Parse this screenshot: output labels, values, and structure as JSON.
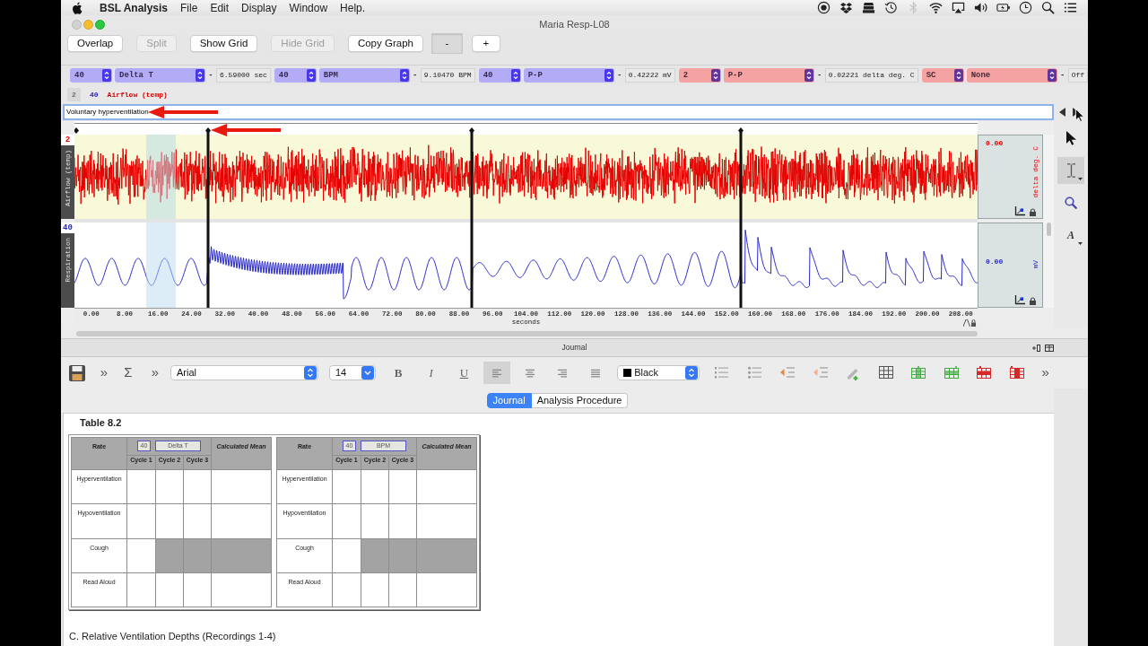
{
  "menubar": {
    "app": "BSL Analysis",
    "menus": [
      "File",
      "Edit",
      "Display",
      "Window",
      "Help."
    ]
  },
  "window": {
    "title": "Maria Resp-L08"
  },
  "toolbar": [
    {
      "label": "Overlap",
      "disabled": false,
      "pressed": false
    },
    {
      "label": "Split",
      "disabled": true,
      "pressed": false
    },
    {
      "label": "Show Grid",
      "disabled": false,
      "pressed": false
    },
    {
      "label": "Hide Grid",
      "disabled": true,
      "pressed": false
    },
    {
      "label": "Copy Graph",
      "disabled": false,
      "pressed": false
    },
    {
      "label": "-",
      "disabled": false,
      "pressed": true
    },
    {
      "label": "+",
      "disabled": false,
      "pressed": false
    }
  ],
  "measurements": [
    {
      "channel": "40",
      "type": "Delta T",
      "separator": "-",
      "result": "6.59000 sec",
      "color": "#b4abf6"
    },
    {
      "channel": "40",
      "type": "BPM",
      "separator": "-",
      "result": "9.10470 BPM",
      "color": "#b4abf6"
    },
    {
      "channel": "40",
      "type": "P-P",
      "separator": "-",
      "result": "0.42222 mV",
      "color": "#b4abf6"
    },
    {
      "channel": "2",
      "type": "P-P",
      "separator": "-",
      "result": "0.02221 delta deg. C",
      "color": "#f4a2a2"
    },
    {
      "channel": "SC",
      "type": "None",
      "separator": "-",
      "result": "Off",
      "color": "#f4a2a2"
    }
  ],
  "channel_bar": {
    "number": "2",
    "channel": "40",
    "label": "Airflow (temp)"
  },
  "event_field": {
    "value": "Voluntary hyperventilation"
  },
  "graph": {
    "channels": [
      {
        "number": "2",
        "name": "Airflow (temp)",
        "scale": "0.00",
        "unit": "delta deg. C",
        "color": "#e60000",
        "kind": "noise"
      },
      {
        "number": "40",
        "name": "Respiration",
        "scale": "0.00",
        "unit": "mV",
        "color": "#2626c8",
        "kind": "breathing"
      }
    ],
    "x_ticks": [
      "0.00",
      "8.00",
      "16.00",
      "24.00",
      "32.00",
      "40.00",
      "48.00",
      "56.00",
      "64.00",
      "72.00",
      "80.00",
      "88.00",
      "96.00",
      "104.00",
      "112.00",
      "120.00",
      "128.00",
      "136.00",
      "144.00",
      "152.00",
      "160.00",
      "168.00",
      "176.00",
      "184.00",
      "192.00",
      "200.00",
      "208.00"
    ],
    "x_label": "seconds"
  },
  "tools": [
    {
      "kind": "pointer",
      "selected": false
    },
    {
      "kind": "ibeam",
      "selected": true
    },
    {
      "kind": "zoom",
      "selected": false
    },
    {
      "kind": "text",
      "glyph": "A",
      "selected": false
    }
  ],
  "journal": {
    "title": "Journal",
    "toolbar": {
      "glyph_buttons": [
        "»",
        "Σ",
        "»"
      ],
      "font": "Arial",
      "size": "14",
      "styles": [
        {
          "glyph": "B",
          "kind": "bold"
        },
        {
          "glyph": "I",
          "kind": "italic"
        },
        {
          "glyph": "U",
          "kind": "underline"
        }
      ],
      "alignments": [
        {
          "selected": true
        },
        {
          "selected": false
        },
        {
          "selected": false
        },
        {
          "selected": false
        }
      ],
      "font_color": "Black",
      "overflow": "»"
    },
    "tabs": [
      {
        "label": "Journal",
        "selected": true
      },
      {
        "label": "Analysis Procedure",
        "selected": false
      }
    ]
  },
  "document": {
    "heading": "Table 8.2",
    "tables": [
      {
        "rate": "Rate",
        "channel": "40",
        "measurement": "Delta T",
        "mean": "Calculated Mean",
        "cycles": [
          "Cycle 1",
          "Cycle 2",
          "Cycle 3"
        ],
        "rows": [
          {
            "label": "Hyperventilation",
            "cells": [
              {
                "shaded": false
              },
              {
                "shaded": false
              },
              {
                "shaded": false
              },
              {
                "shaded": false
              }
            ]
          },
          {
            "label": "Hypoventilation",
            "cells": [
              {
                "shaded": false
              },
              {
                "shaded": false
              },
              {
                "shaded": false
              },
              {
                "shaded": false
              }
            ]
          },
          {
            "label": "Cough",
            "cells": [
              {
                "shaded": false
              },
              {
                "shaded": true
              },
              {
                "shaded": true
              },
              {
                "shaded": true
              }
            ]
          },
          {
            "label": "Read Aloud",
            "cells": [
              {
                "shaded": false
              },
              {
                "shaded": false
              },
              {
                "shaded": false
              },
              {
                "shaded": false
              }
            ]
          }
        ]
      },
      {
        "rate": "Rate",
        "channel": "40",
        "measurement": "BPM",
        "mean": "Calculated Mean",
        "cycles": [
          "Cycle 1",
          "Cycle 2",
          "Cycle 3"
        ],
        "rows": [
          {
            "label": "Hyperventilation",
            "cells": [
              {
                "shaded": false
              },
              {
                "shaded": false
              },
              {
                "shaded": false
              },
              {
                "shaded": false
              }
            ]
          },
          {
            "label": "Hypoventilation",
            "cells": [
              {
                "shaded": false
              },
              {
                "shaded": false
              },
              {
                "shaded": false
              },
              {
                "shaded": false
              }
            ]
          },
          {
            "label": "Cough",
            "cells": [
              {
                "shaded": false
              },
              {
                "shaded": true
              },
              {
                "shaded": true
              },
              {
                "shaded": true
              }
            ]
          },
          {
            "label": "Read Aloud",
            "cells": [
              {
                "shaded": false
              },
              {
                "shaded": false
              },
              {
                "shaded": false
              },
              {
                "shaded": false
              }
            ]
          }
        ]
      }
    ],
    "section": "C. Relative Ventilation Depths (Recordings 1-4)"
  }
}
